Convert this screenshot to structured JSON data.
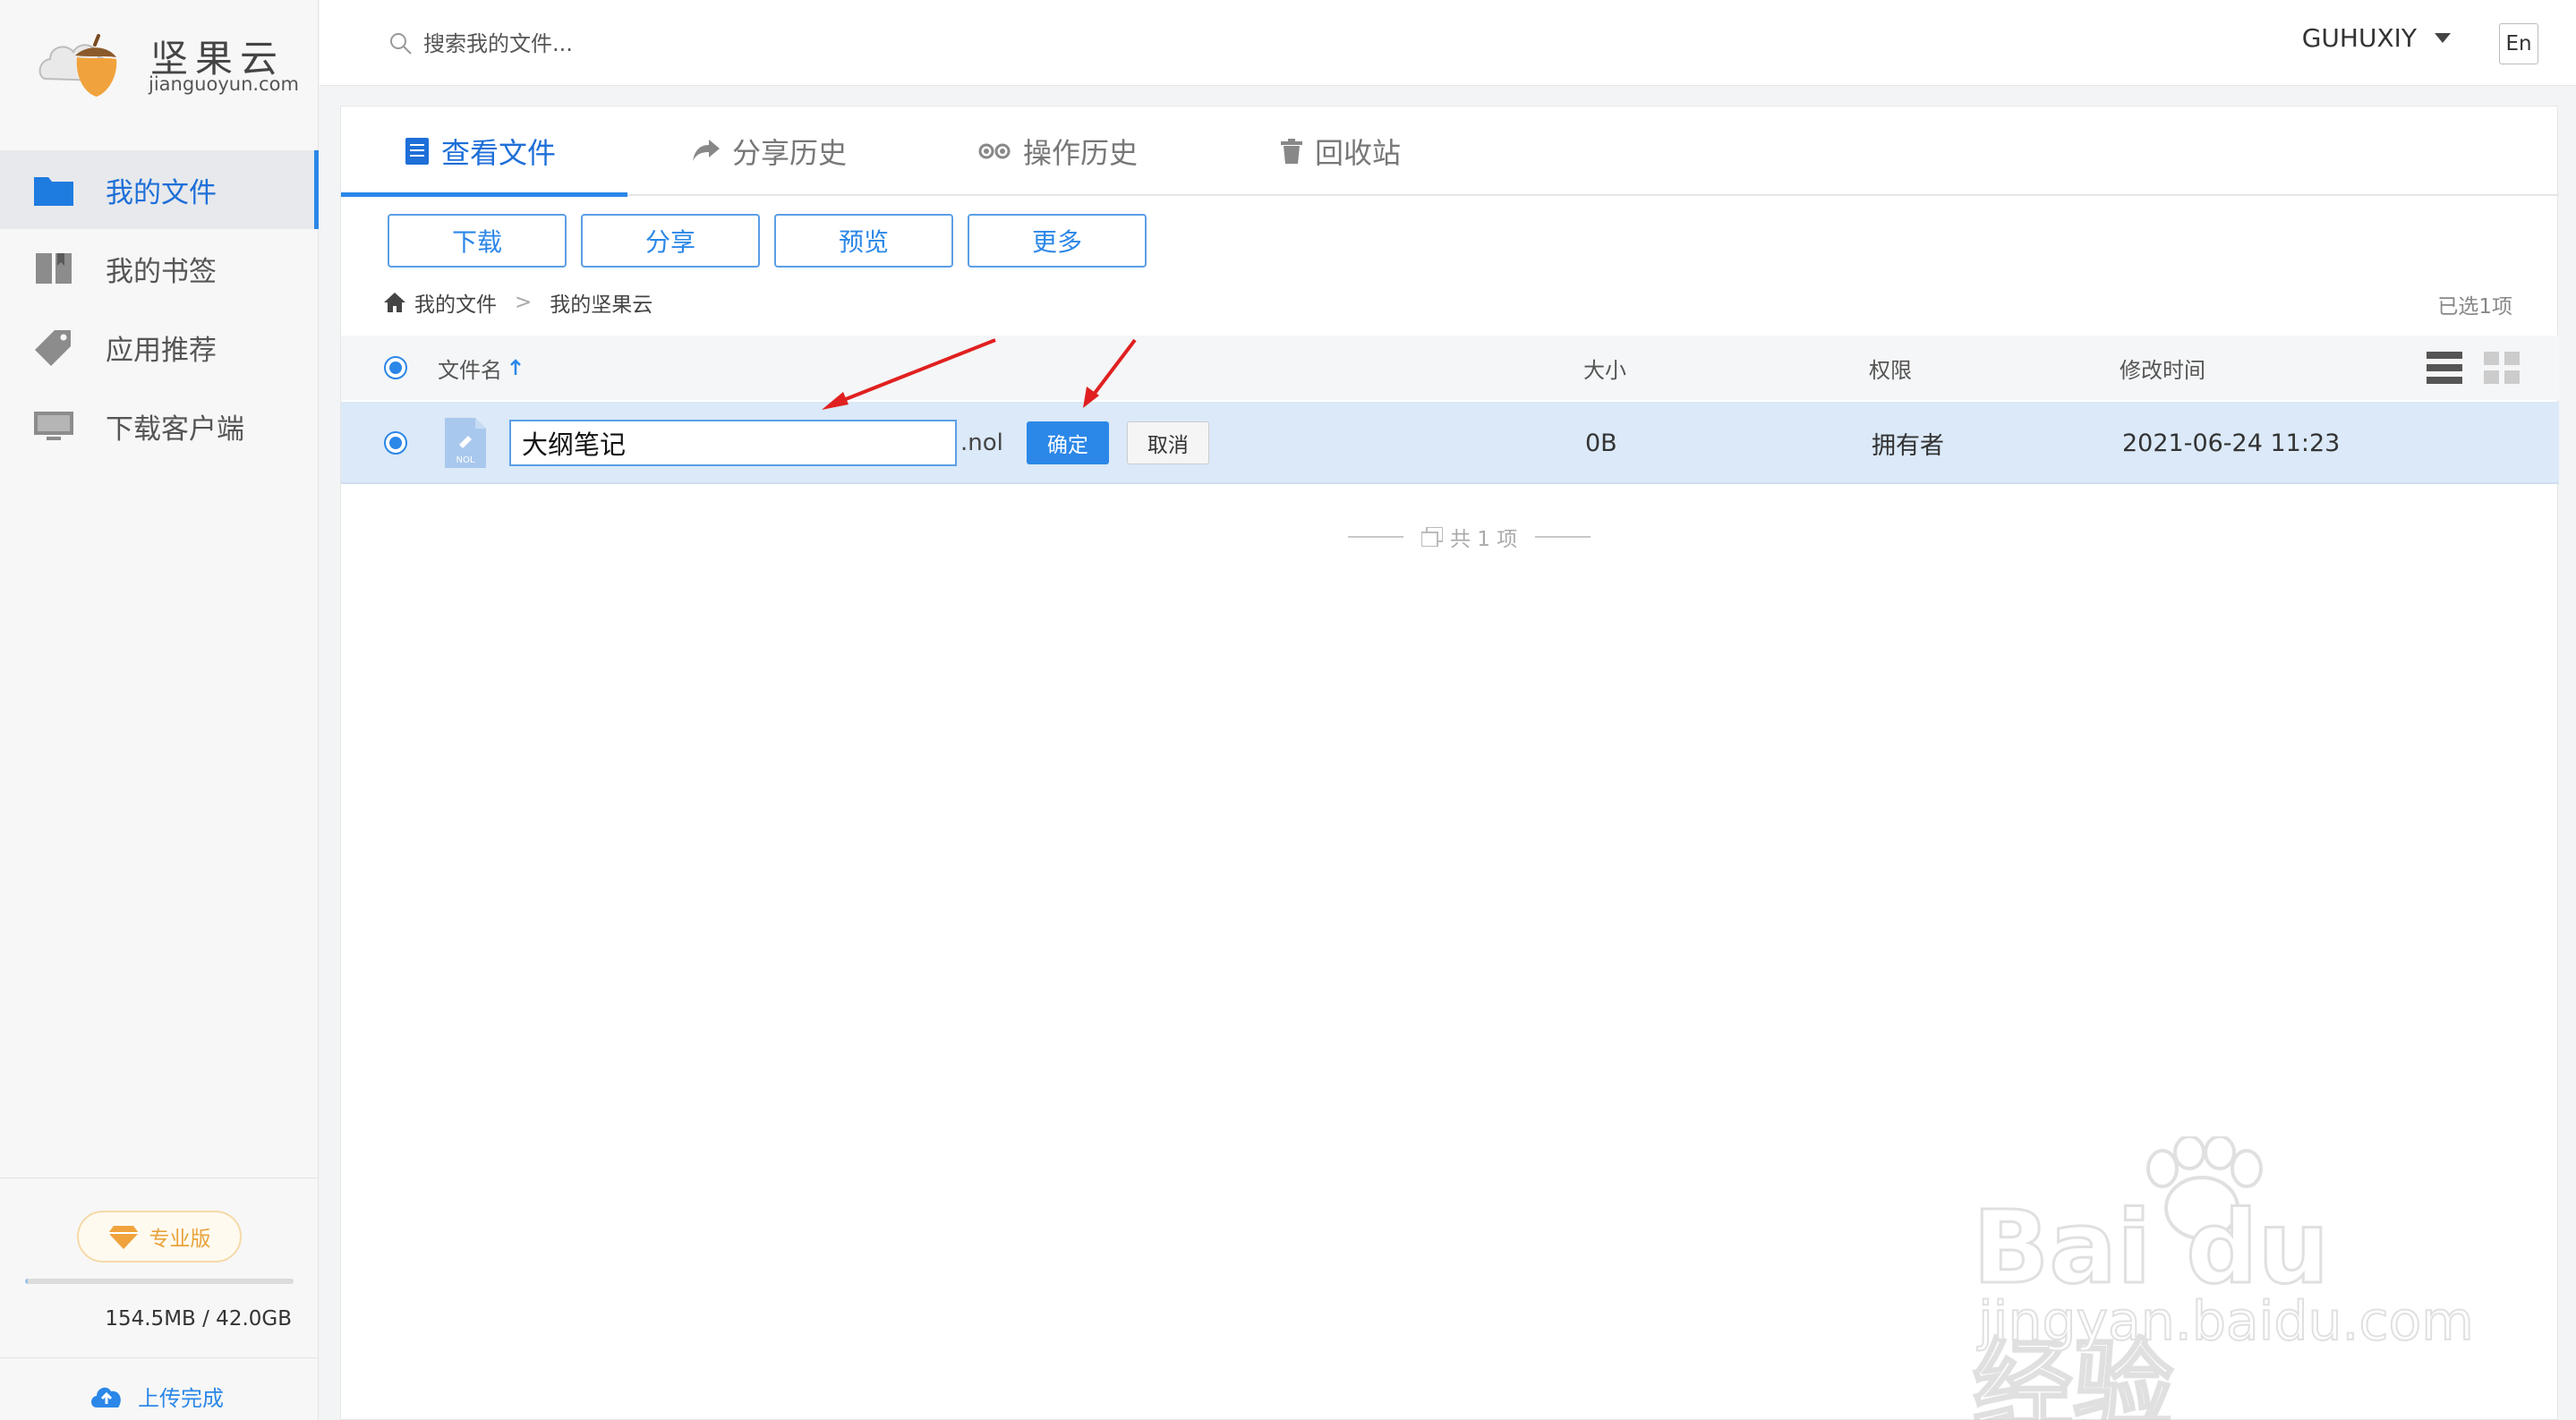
{
  "app": {
    "logo_text": "坚果云",
    "logo_sub": "jianguoyun.com"
  },
  "sidebar": {
    "items": [
      {
        "label": "我的文件",
        "icon": "folder-icon",
        "active": true
      },
      {
        "label": "我的书签",
        "icon": "bookmark-icon",
        "active": false
      },
      {
        "label": "应用推荐",
        "icon": "tag-icon",
        "active": false
      },
      {
        "label": "下载客户端",
        "icon": "monitor-icon",
        "active": false
      }
    ],
    "pro_badge": "专业版",
    "quota_text": "154.5MB / 42.0GB",
    "quota_fraction": 0.0036,
    "upload_status": "上传完成"
  },
  "topbar": {
    "search_placeholder": "搜索我的文件...",
    "username": "GUHUXIY",
    "lang_button": "En"
  },
  "tabs": [
    {
      "label": "查看文件",
      "icon": "file-icon",
      "active": true
    },
    {
      "label": "分享历史",
      "icon": "share-icon",
      "active": false
    },
    {
      "label": "操作历史",
      "icon": "history-icon",
      "active": false
    },
    {
      "label": "回收站",
      "icon": "trash-icon",
      "active": false
    }
  ],
  "toolbar": {
    "download": "下载",
    "share": "分享",
    "preview": "预览",
    "more": "更多"
  },
  "breadcrumb": {
    "root": "我的文件",
    "separator": ">",
    "current": "我的坚果云"
  },
  "selected_count": "已选1项",
  "table": {
    "headers": {
      "name": "文件名",
      "size": "大小",
      "permission": "权限",
      "modified": "修改时间"
    },
    "rows": [
      {
        "name_value": "大纲笔记",
        "extension": ".nol",
        "file_icon_label": "NOL",
        "confirm": "确定",
        "cancel": "取消",
        "size": "0B",
        "permission": "拥有者",
        "modified": "2021-06-24 11:23"
      }
    ]
  },
  "footer_total": "共 1 项",
  "watermark": {
    "brand": "Bai du 经验",
    "url": "jingyan.baidu.com"
  },
  "colors": {
    "accent": "#2b87e8",
    "selected_row": "#dbe9f8",
    "pro": "#e8a33a",
    "annotation_arrow": "#e02020"
  }
}
